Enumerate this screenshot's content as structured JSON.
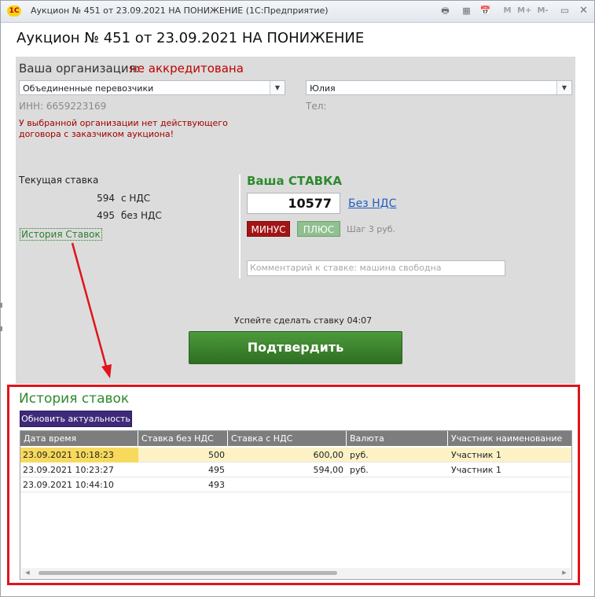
{
  "window": {
    "title": "Аукцион № 451 от 23.09.2021 НА ПОНИЖЕНИЕ  (1С:Предприятие)",
    "logo_text": "1С",
    "toolbar_letters": [
      "M",
      "M+",
      "M-"
    ]
  },
  "page_title": "Аукцион № 451 от 23.09.2021 НА ПОНИЖЕНИЕ",
  "organization": {
    "label": "Ваша организация:",
    "status": "не аккредитована",
    "org_value": "Объединенные перевозчики",
    "contact_value": "Юлия",
    "inn": "ИНН: 6659223169",
    "phone": "Тел:",
    "warning": "У выбранной организации нет действующего договора с заказчиком аукциона!"
  },
  "current_bid": {
    "title": "Текущая ставка",
    "with_vat_value": "594",
    "with_vat_label": "с НДС",
    "without_vat_value": "495",
    "without_vat_label": "без НДС",
    "history_link": "История Ставок"
  },
  "your_bid": {
    "title": "Ваша СТАВКА",
    "value": "10577",
    "vat_link": "Без НДС",
    "minus_label": "МИНУС",
    "plus_label": "ПЛЮС",
    "step": "Шаг 3 руб.",
    "comment_placeholder": "Комментарий к ставке: машина свободна"
  },
  "timer_text": "Успейте сделать ставку 04:07",
  "confirm_label": "Подтвердить",
  "history": {
    "title": "История ставок",
    "refresh_label": "Обновить актуальность",
    "columns": [
      "Дата время",
      "Ставка без НДС",
      "Ставка с НДС",
      "Валюта",
      "Участник наименование"
    ],
    "rows": [
      [
        "23.09.2021 10:18:23",
        "500",
        "600,00",
        "руб.",
        "Участник 1"
      ],
      [
        "23.09.2021 10:23:27",
        "495",
        "594,00",
        "руб.",
        "Участник 1"
      ],
      [
        "23.09.2021 10:44:10",
        "493",
        "",
        "",
        ""
      ]
    ]
  },
  "colors": {
    "accent_green": "#2d8a2d",
    "alert_red": "#c00000",
    "annotation_red": "#e0141b",
    "refresh_button": "#3e2a7a"
  }
}
